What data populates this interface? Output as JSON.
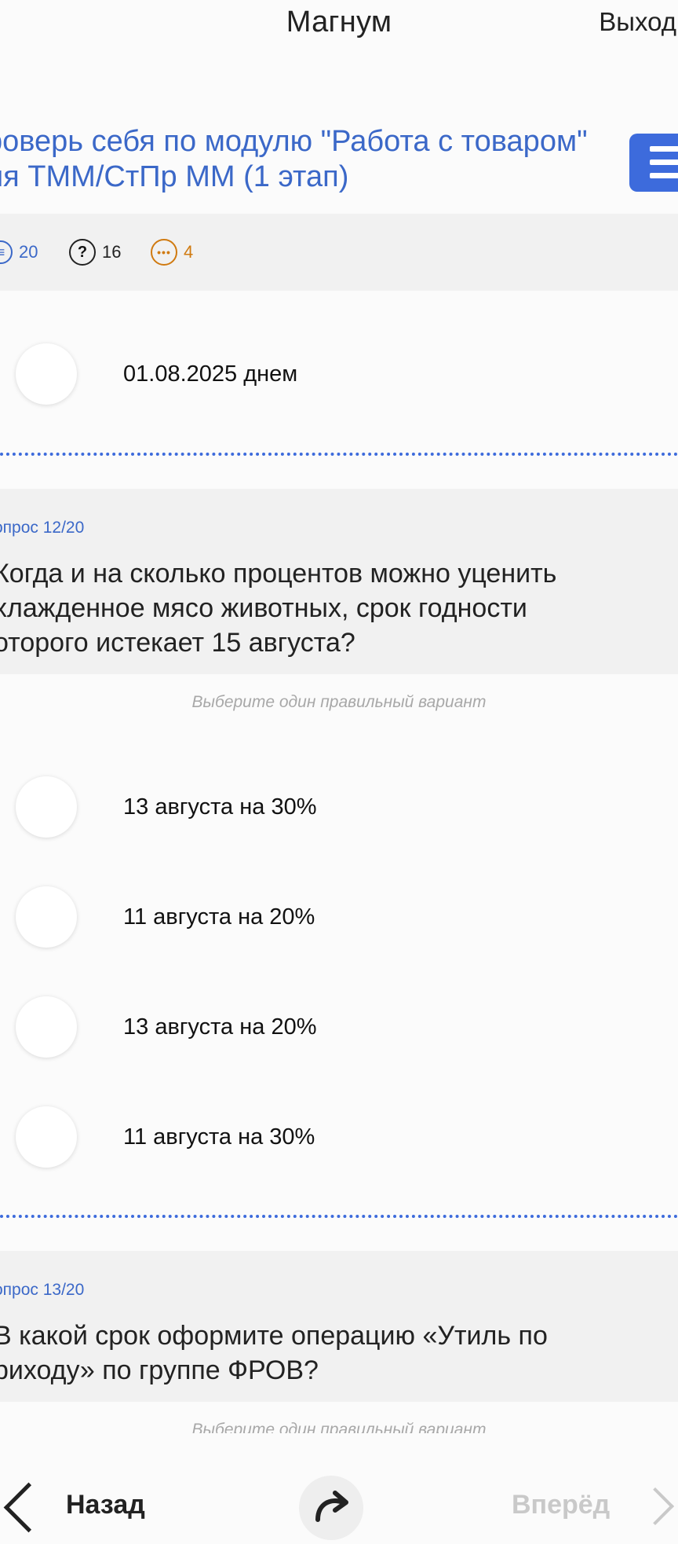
{
  "header": {
    "app_title": "Магнум",
    "logout_label": "Выход"
  },
  "test": {
    "title_line1": "роверь себя по модулю \"Работа с товаром\"",
    "title_line2": "ля ТММ/СтПр ММ (1 этап)"
  },
  "stats": {
    "total": "20",
    "unanswered": "16",
    "pending": "4",
    "colors": {
      "total": "#3b68c8",
      "unanswered": "#222222",
      "pending": "#d07a10"
    }
  },
  "prev_question_option": {
    "label": "01.08.2025 днем"
  },
  "question_12": {
    "number": "опрос 12/20",
    "line1": "Когда и на сколько процентов можно уценить",
    "line2": "хлажденное мясо животных, срок годности",
    "line3": "оторого истекает 15 августа?",
    "hint": "Выберите один правильный вариант",
    "options": [
      "13 августа на 30%",
      "11 августа на 20%",
      "13 августа на 20%",
      "11 августа на 30%"
    ]
  },
  "question_13": {
    "number": "опрос 13/20",
    "line1": "В какой срок оформите операцию «Утиль по",
    "line2": "риходу» по группе ФРОВ?",
    "hint": "Выберите один правильный вариант"
  },
  "nav": {
    "back_label": "Назад",
    "forward_label": "Вперёд"
  },
  "accent_color": "#3d6bdc"
}
